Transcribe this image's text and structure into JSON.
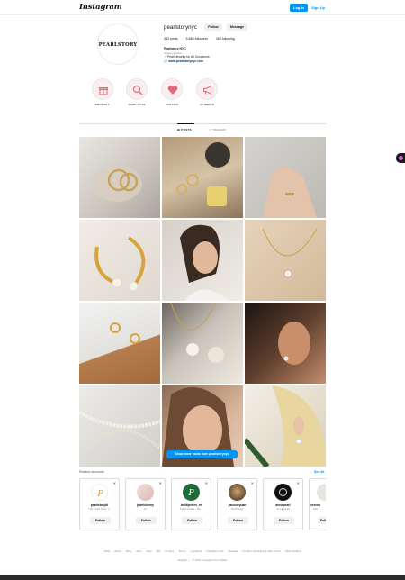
{
  "header": {
    "logo": "Instagram",
    "login_label": "Log in",
    "signup_label": "Sign Up"
  },
  "profile": {
    "avatar_text": "PEARLSTORY",
    "username": "pearlstorynyc",
    "follow_label": "Follow",
    "message_label": "Message",
    "posts": "383 posts",
    "followers": "5,685 followers",
    "following": "453 following",
    "name": "Pearlstory NYC",
    "category": "Jewelry/watches",
    "bio_line": "Pearl Jewelry for All Occasions",
    "link": "www.pearlstorynyc.com"
  },
  "highlights": [
    {
      "label": "UNBOXING T...",
      "icon": "gift-icon"
    },
    {
      "label": "PEARL STYLE",
      "icon": "search-icon"
    },
    {
      "label": "OUR FAVS",
      "icon": "heart-icon"
    },
    {
      "label": "AS SEEN IN",
      "icon": "megaphone-icon"
    }
  ],
  "tabs": [
    {
      "label": "POSTS",
      "active": true
    },
    {
      "label": "TAGGED",
      "active": false
    }
  ],
  "grid": {
    "show_more_label": "Show more posts from pearlstorynyc"
  },
  "related": {
    "title": "Related accounts",
    "see_all": "See all",
    "accounts": [
      {
        "username": "pearlstorybl",
        "sub": "The Pearl Story |...",
        "follow": "Follow"
      },
      {
        "username": "jewelchemy",
        "sub": "M",
        "follow": "Follow"
      },
      {
        "username": "tahitiperles_re",
        "sub": "Tahiti Perles - Re...",
        "follow": "Follow"
      },
      {
        "username": "yacoooyuan",
        "sub": "YACOyuan",
        "follow": "Follow"
      },
      {
        "username": "annopearl",
        "sub": "Anna pearl",
        "follow": "Follow"
      },
      {
        "username": "serena",
        "sub": "SEI",
        "follow": "Follo"
      }
    ]
  },
  "footer": {
    "links": [
      "Meta",
      "About",
      "Blog",
      "Jobs",
      "Help",
      "API",
      "Privacy",
      "Terms",
      "Locations",
      "Instagram Lite",
      "Threads",
      "Contact Uploading & Non-Users",
      "Meta Verified"
    ],
    "language": "English",
    "copyright": "© 2024 Instagram from Meta"
  },
  "colors": {
    "accent": "#0095f6",
    "text": "#262626",
    "muted": "#8e8e8e",
    "highlight_bg": "#fbeeee",
    "highlight_icon": "#e06a7a"
  }
}
